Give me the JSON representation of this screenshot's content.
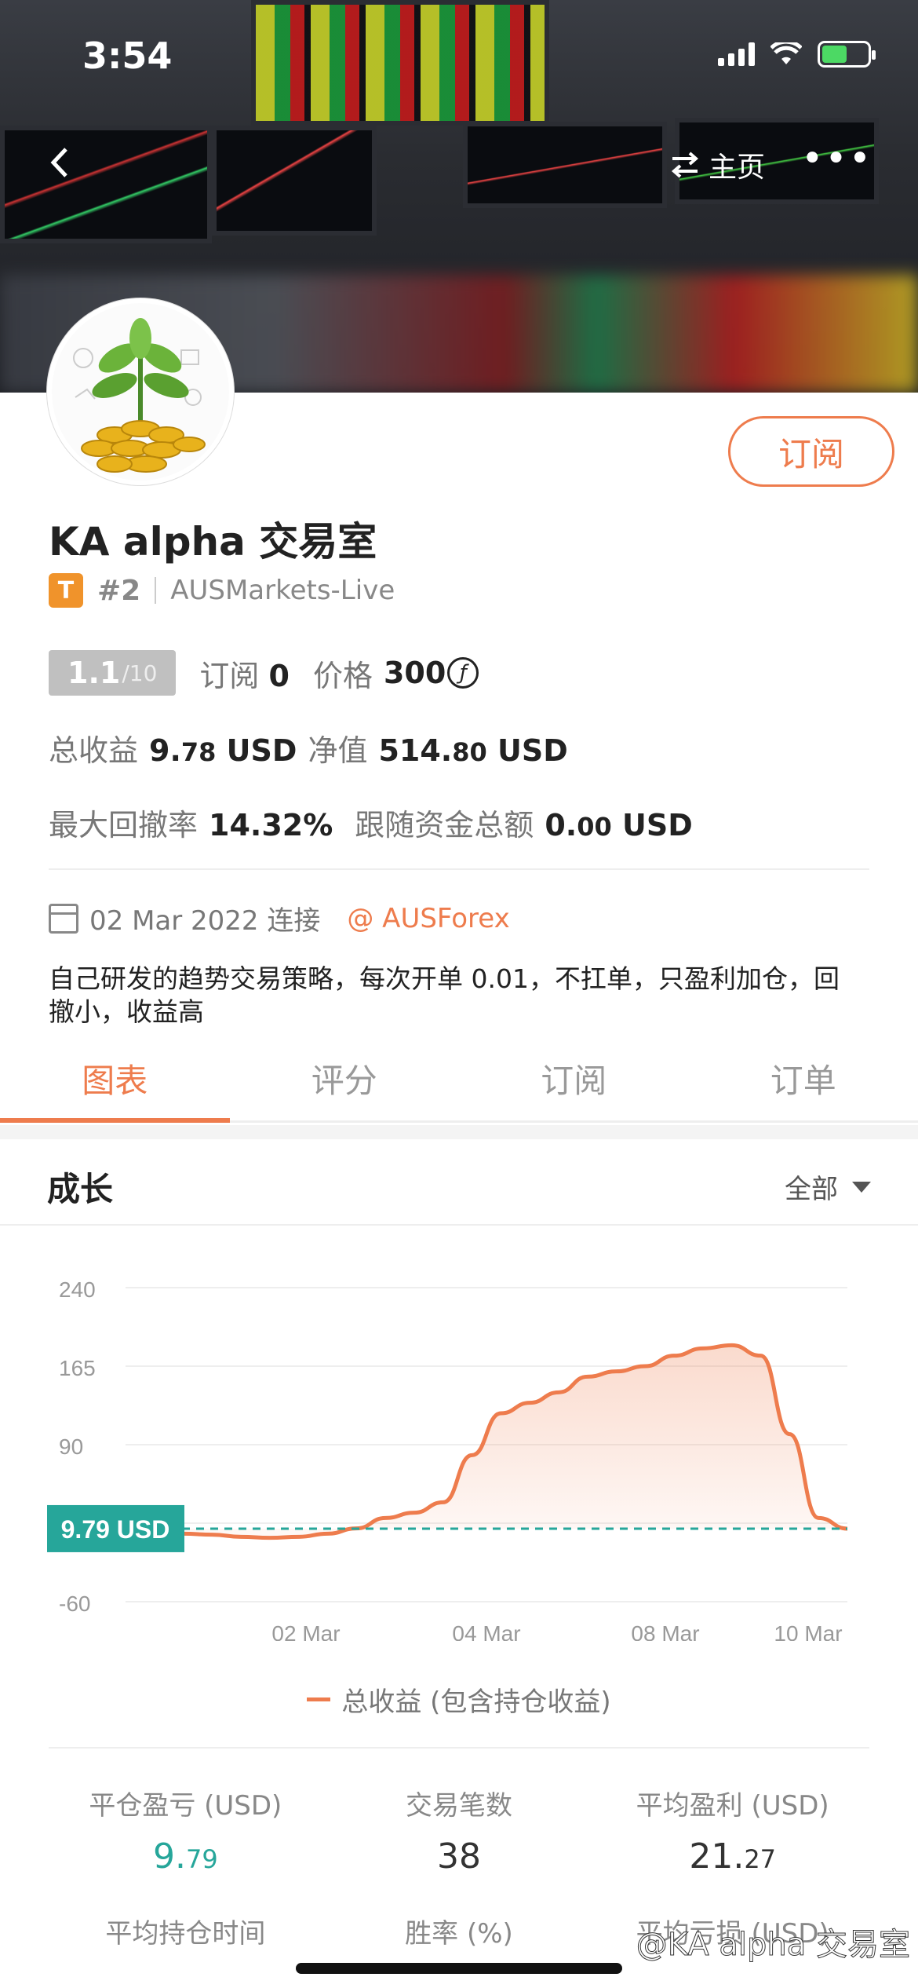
{
  "status": {
    "time": "3:54"
  },
  "nav": {
    "home_label": "主页"
  },
  "profile": {
    "subscribe_label": "订阅",
    "title": "KA  alpha 交易室",
    "tier_badge": "T",
    "rank": "#2",
    "server": "AUSMarkets-Live",
    "score": "1.1",
    "score_max": "/10",
    "subscribers_label": "订阅",
    "subscribers": "0",
    "price_label": "价格",
    "price": "300",
    "coin_symbol": "ƒ"
  },
  "stats_top": {
    "total_profit_label": "总收益",
    "total_profit_int": "9.",
    "total_profit_dec": "78",
    "total_profit_unit": "USD",
    "equity_label": "净值",
    "equity_int": "514.",
    "equity_dec": "80",
    "equity_unit": "USD",
    "max_dd_label": "最大回撤率",
    "max_dd": "14.32%",
    "follow_label": "跟随资金总额",
    "follow_int": "0.",
    "follow_dec": "00",
    "follow_unit": "USD"
  },
  "connection": {
    "date": "02 Mar 2022 连接",
    "mention": "@ AUSForex"
  },
  "description": "自己研发的趋势交易策略，每次开单 0.01，不扛单，只盈利加仓，回撤小，收益高",
  "tabs": [
    "图表",
    "评分",
    "订阅",
    "订单"
  ],
  "growth": {
    "title": "成长",
    "filter": "全部"
  },
  "chart_data": {
    "type": "area",
    "yticks": [
      "240",
      "165",
      "90",
      "-60"
    ],
    "ylim": [
      -60,
      240
    ],
    "xticks": [
      "02 Mar",
      "04 Mar",
      "08 Mar",
      "10 Mar"
    ],
    "current_label": "9.79 USD",
    "current_value": 9.79,
    "series": [
      {
        "name": "总收益 (包含持仓收益)",
        "values": [
          5,
          5,
          5,
          4,
          2,
          1,
          2,
          5,
          10,
          20,
          25,
          35,
          80,
          120,
          130,
          140,
          155,
          160,
          165,
          175,
          182,
          185,
          175,
          100,
          20,
          9.79
        ]
      }
    ],
    "accent": "#ee7c4d",
    "baseline_color": "#26a69a"
  },
  "legend_label": "总收益 (包含持仓收益)",
  "stats_grid": {
    "closed_pl_label": "平仓盈亏 (USD)",
    "closed_pl_int": "9.",
    "closed_pl_dec": "79",
    "trades_label": "交易笔数",
    "trades": "38",
    "avg_profit_label": "平均盈利 (USD)",
    "avg_profit_int": "21.",
    "avg_profit_dec": "27",
    "avg_hold_label": "平均持仓时间",
    "win_rate_label": "胜率 (%)",
    "avg_loss_label": "平均亏损 (USD)"
  },
  "watermark": "@KA alpha 交易室"
}
